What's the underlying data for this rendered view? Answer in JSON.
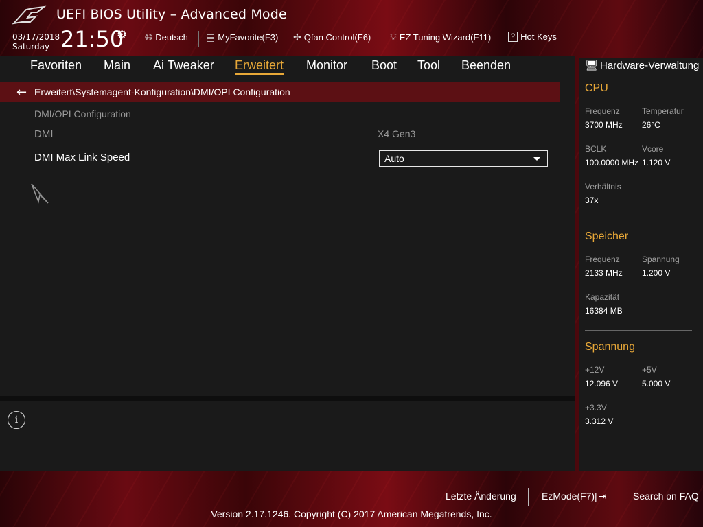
{
  "header": {
    "title": "UEFI BIOS Utility – Advanced Mode",
    "date": "03/17/2018",
    "weekday": "Saturday",
    "time": "21:50",
    "tools": {
      "language": "Deutsch",
      "myfavorite": "MyFavorite(F3)",
      "qfan": "Qfan Control(F6)",
      "ez_tuning": "EZ Tuning Wizard(F11)",
      "hotkeys": "Hot Keys"
    }
  },
  "nav": {
    "items": [
      "Favoriten",
      "Main",
      "Ai Tweaker",
      "Erweitert",
      "Monitor",
      "Boot",
      "Tool",
      "Beenden"
    ],
    "active": "Erweitert"
  },
  "main": {
    "breadcrumb": "Erweitert\\Systemagent-Konfiguration\\DMI/OPI Configuration",
    "section_heading": "DMI/OPI Configuration",
    "dmi": {
      "label": "DMI",
      "value": "X4  Gen3"
    },
    "dmi_max_link_speed": {
      "label": "DMI Max Link Speed",
      "value": "Auto"
    }
  },
  "hardware": {
    "title": "Hardware-Verwaltung",
    "cpu": {
      "heading": "CPU",
      "freq_label": "Frequenz",
      "freq": "3700 MHz",
      "temp_label": "Temperatur",
      "temp": "26°C",
      "bclk_label": "BCLK",
      "bclk": "100.0000 MHz",
      "vcore_label": "Vcore",
      "vcore": "1.120 V",
      "ratio_label": "Verhältnis",
      "ratio": "37x"
    },
    "memory": {
      "heading": "Speicher",
      "freq_label": "Frequenz",
      "freq": "2133 MHz",
      "voltage_label": "Spannung",
      "voltage": "1.200 V",
      "capacity_label": "Kapazität",
      "capacity": "16384 MB"
    },
    "voltage": {
      "heading": "Spannung",
      "v12_label": "+12V",
      "v12": "12.096 V",
      "v5_label": "+5V",
      "v5": "5.000 V",
      "v33_label": "+3.3V",
      "v33": "3.312 V"
    }
  },
  "footer": {
    "last_change": "Letzte Änderung",
    "ezmode": "EzMode(F7)|",
    "faq": "Search on FAQ",
    "version": "Version 2.17.1246. Copyright (C) 2017 American Megatrends, Inc."
  },
  "colors": {
    "accent": "#e8a838",
    "breadcrumb_bg": "#5c1014",
    "panel_bg": "#1a1a1a"
  }
}
